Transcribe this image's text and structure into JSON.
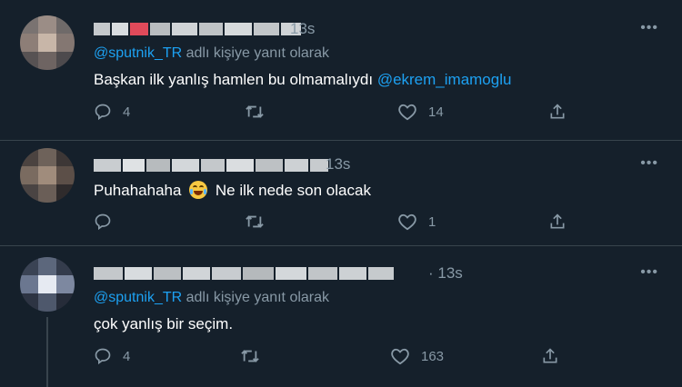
{
  "tweets": [
    {
      "time": "13s",
      "more": "•••",
      "reply_prefix": "@sputnik_TR",
      "reply_suffix": " adlı kişiye yanıt olarak",
      "text": "Başkan ilk yanlış hamlen bu olmamalıydı ",
      "mention": "@ekrem_imamoglu",
      "replies": "4",
      "retweets": "",
      "likes": "14"
    },
    {
      "time": "13s",
      "more": "•••",
      "text_before": "Puhahahaha",
      "text_after": "Ne ilk nede son olacak",
      "replies": "",
      "retweets": "",
      "likes": "1"
    },
    {
      "time": "· 13s",
      "more": "•••",
      "reply_prefix": "@sputnik_TR",
      "reply_suffix": " adlı kişiye yanıt olarak",
      "text": "çok yanlış bir seçim.",
      "replies": "4",
      "retweets": "",
      "likes": "163"
    }
  ],
  "colors": {
    "background": "#15202b",
    "text": "#ffffff",
    "muted": "#8899a6",
    "accent": "#1da1f2",
    "divider": "#38444d"
  },
  "icons": [
    "reply-icon",
    "retweet-icon",
    "like-icon",
    "share-icon",
    "more-icon",
    "emoji-joy-icon"
  ]
}
